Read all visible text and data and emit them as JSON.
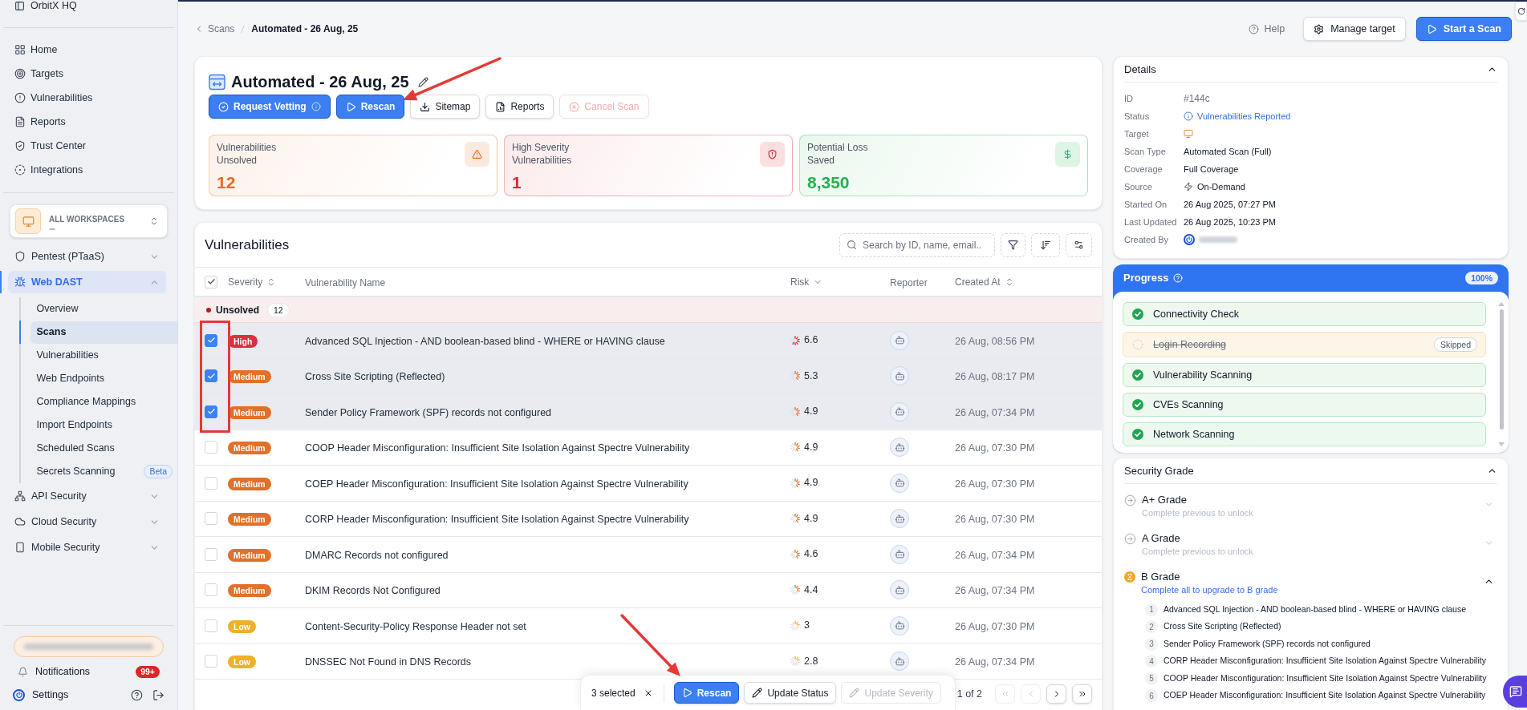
{
  "sidebar": {
    "org": "OrbitX HQ",
    "nav": [
      {
        "label": "Home",
        "selected": false
      },
      {
        "label": "Targets",
        "selected": false
      },
      {
        "label": "Vulnerabilities",
        "selected": false
      },
      {
        "label": "Reports",
        "selected": false
      },
      {
        "label": "Trust Center",
        "selected": false
      },
      {
        "label": "Integrations",
        "selected": false
      }
    ],
    "workspace": {
      "label": "ALL WORKSPACES"
    },
    "products": [
      {
        "label": "Pentest (PTaaS)",
        "selected": false,
        "expanded": false
      },
      {
        "label": "Web DAST",
        "selected": true,
        "expanded": true,
        "children": [
          {
            "label": "Overview",
            "selected": false
          },
          {
            "label": "Scans",
            "selected": true
          },
          {
            "label": "Vulnerabilities",
            "selected": false
          },
          {
            "label": "Web Endpoints",
            "selected": false
          },
          {
            "label": "Compliance Mappings",
            "selected": false
          },
          {
            "label": "Import Endpoints",
            "selected": false
          },
          {
            "label": "Scheduled Scans",
            "selected": false
          },
          {
            "label": "Secrets Scanning",
            "selected": false,
            "badge": "Beta"
          }
        ]
      },
      {
        "label": "API Security",
        "selected": false,
        "expanded": false
      },
      {
        "label": "Cloud Security",
        "selected": false,
        "expanded": false
      },
      {
        "label": "Mobile Security",
        "selected": false,
        "expanded": false
      }
    ],
    "notifications": {
      "label": "Notifications",
      "badge": "99+"
    },
    "settings": {
      "label": "Settings"
    }
  },
  "breadcrumb": [
    {
      "label": "Scans"
    },
    {
      "label": "Automated - 26 Aug, 25"
    }
  ],
  "header": {
    "help": "Help",
    "buttons": [
      {
        "label": "Manage target",
        "kind": "outline"
      },
      {
        "label": "Start a Scan",
        "kind": "primary"
      }
    ]
  },
  "scan": {
    "title": "Automated - 26 Aug, 25",
    "actions": [
      {
        "label": "Request Vetting",
        "kind": "primary",
        "disabled": false
      },
      {
        "label": "Rescan",
        "kind": "primary",
        "disabled": false
      },
      {
        "label": "Sitemap",
        "kind": "outline",
        "disabled": false
      },
      {
        "label": "Reports",
        "kind": "outline",
        "disabled": false
      },
      {
        "label": "Cancel Scan",
        "kind": "danger",
        "disabled": true
      }
    ],
    "stats": [
      {
        "kind": "warning",
        "label": "Vulnerabilities Unsolved",
        "value": "12",
        "color": "#ea6a1f"
      },
      {
        "kind": "shield",
        "label": "High Severity Vulnerabilities",
        "value": "1",
        "color": "#dc2636"
      },
      {
        "kind": "money",
        "label": "Potential Loss Saved",
        "value": "8,350",
        "color": "#22b24c"
      }
    ]
  },
  "vulnerabilities": {
    "title": "Vulnerabilities",
    "search": {
      "placeholder": "Search by ID, name, email.."
    },
    "all_checked": true,
    "columns": [
      {
        "label": "Severity",
        "sortable": true,
        "sorted": false
      },
      {
        "label": "Vulnerability Name",
        "sortable": false,
        "sorted": false
      },
      {
        "label": "Risk",
        "sortable": true,
        "sorted": true
      },
      {
        "label": "Reporter",
        "sortable": false,
        "sorted": false
      },
      {
        "label": "Created At",
        "sortable": true,
        "sorted": false
      }
    ],
    "group": {
      "label": "Unsolved",
      "count": "12",
      "color": "#b91c1c"
    },
    "rows": [
      {
        "selected": true,
        "severity": {
          "label": "High",
          "color": "#dc2f3f"
        },
        "name": "Advanced SQL Injection - AND boolean-based blind - WHERE or HAVING clause",
        "risk": {
          "value": "6.6",
          "level": 0.66
        },
        "created_at": "26 Aug, 08:56 PM"
      },
      {
        "selected": true,
        "severity": {
          "label": "Medium",
          "color": "#e0702a"
        },
        "name": "Cross Site Scripting (Reflected)",
        "risk": {
          "value": "5.3",
          "level": 0.53
        },
        "created_at": "26 Aug, 08:17 PM"
      },
      {
        "selected": true,
        "severity": {
          "label": "Medium",
          "color": "#e0702a"
        },
        "name": "Sender Policy Framework (SPF) records not configured",
        "risk": {
          "value": "4.9",
          "level": 0.49
        },
        "created_at": "26 Aug, 07:34 PM"
      },
      {
        "selected": false,
        "severity": {
          "label": "Medium",
          "color": "#e0702a"
        },
        "name": "COOP Header Misconfiguration: Insufficient Site Isolation Against Spectre Vulnerability",
        "risk": {
          "value": "4.9",
          "level": 0.49
        },
        "created_at": "26 Aug, 07:30 PM"
      },
      {
        "selected": false,
        "severity": {
          "label": "Medium",
          "color": "#e0702a"
        },
        "name": "COEP Header Misconfiguration: Insufficient Site Isolation Against Spectre Vulnerability",
        "risk": {
          "value": "4.9",
          "level": 0.49
        },
        "created_at": "26 Aug, 07:30 PM"
      },
      {
        "selected": false,
        "severity": {
          "label": "Medium",
          "color": "#e0702a"
        },
        "name": "CORP Header Misconfiguration: Insufficient Site Isolation Against Spectre Vulnerability",
        "risk": {
          "value": "4.9",
          "level": 0.49
        },
        "created_at": "26 Aug, 07:30 PM"
      },
      {
        "selected": false,
        "severity": {
          "label": "Medium",
          "color": "#e0702a"
        },
        "name": "DMARC Records not configured",
        "risk": {
          "value": "4.6",
          "level": 0.46
        },
        "created_at": "26 Aug, 07:34 PM"
      },
      {
        "selected": false,
        "severity": {
          "label": "Medium",
          "color": "#e0702a"
        },
        "name": "DKIM Records Not Configured",
        "risk": {
          "value": "4.4",
          "level": 0.44
        },
        "created_at": "26 Aug, 07:34 PM"
      },
      {
        "selected": false,
        "severity": {
          "label": "Low",
          "color": "#efb02a"
        },
        "name": "Content-Security-Policy Response Header not set",
        "risk": {
          "value": "3",
          "level": 0.3
        },
        "created_at": "26 Aug, 07:30 PM"
      },
      {
        "selected": false,
        "severity": {
          "label": "Low",
          "color": "#efb02a"
        },
        "name": "DNSSEC Not Found in DNS Records",
        "risk": {
          "value": "2.8",
          "level": 0.28
        },
        "created_at": "26 Aug, 07:34 PM"
      }
    ],
    "pagination": {
      "label": "1 of 2",
      "buttons": [
        {
          "disabled": true
        },
        {
          "disabled": true
        },
        {
          "disabled": false
        },
        {
          "disabled": false
        }
      ]
    },
    "bulk_bar": {
      "label": "3 selected",
      "actions": [
        {
          "label": "Rescan",
          "kind": "primary",
          "disabled": false
        },
        {
          "label": "Update Status",
          "kind": "outline",
          "disabled": false
        },
        {
          "label": "Update Severity",
          "kind": "outline",
          "disabled": true
        }
      ]
    }
  },
  "details": {
    "title": "Details",
    "expanded": true,
    "fields": [
      {
        "kind": "id",
        "label": "ID",
        "value": "#144c"
      },
      {
        "kind": "status",
        "label": "Status",
        "value": "Vulnerabilities Reported"
      },
      {
        "kind": "target",
        "label": "Target"
      },
      {
        "kind": "text",
        "label": "Scan Type",
        "value": "Automated Scan (Full)"
      },
      {
        "kind": "text",
        "label": "Coverage",
        "value": "Full Coverage"
      },
      {
        "kind": "source",
        "label": "Source",
        "value": "On-Demand"
      },
      {
        "kind": "text",
        "label": "Started On",
        "value": "26 Aug 2025, 07:27 PM"
      },
      {
        "kind": "text",
        "label": "Last Updated",
        "value": "26 Aug 2025, 10:23 PM"
      },
      {
        "kind": "user",
        "label": "Created By"
      }
    ]
  },
  "progress": {
    "title": "Progress",
    "percent": "100%",
    "steps": [
      {
        "kind": "done",
        "label": "Connectivity Check"
      },
      {
        "kind": "skipped",
        "label": "Login Recording",
        "badge": "Skipped"
      },
      {
        "kind": "done",
        "label": "Vulnerability Scanning"
      },
      {
        "kind": "done",
        "label": "CVEs Scanning"
      },
      {
        "kind": "done",
        "label": "Network Scanning"
      }
    ]
  },
  "security_grade": {
    "title": "Security Grade",
    "expanded": true,
    "grades": [
      {
        "kind": "locked",
        "label": "A+ Grade",
        "hint": "Complete previous to unlock",
        "expanded": false
      },
      {
        "kind": "locked",
        "label": "A Grade",
        "hint": "Complete previous to unlock",
        "expanded": false
      },
      {
        "kind": "current",
        "label": "B Grade",
        "hint": "Complete all to upgrade to B grade",
        "expanded": true,
        "items": [
          {
            "number": "1",
            "label": "Advanced SQL Injection - AND boolean-based blind - WHERE or HAVING clause"
          },
          {
            "number": "2",
            "label": "Cross Site Scripting (Reflected)"
          },
          {
            "number": "3",
            "label": "Sender Policy Framework (SPF) records not configured"
          },
          {
            "number": "4",
            "label": "CORP Header Misconfiguration: Insufficient Site Isolation Against Spectre Vulnerability"
          },
          {
            "number": "5",
            "label": "COOP Header Misconfiguration: Insufficient Site Isolation Against Spectre Vulnerability"
          },
          {
            "number": "6",
            "label": "COEP Header Misconfiguration: Insufficient Site Isolation Against Spectre Vulnerability"
          }
        ]
      }
    ]
  }
}
